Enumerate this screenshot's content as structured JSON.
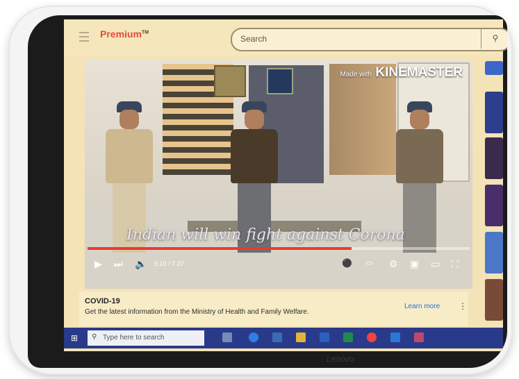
{
  "header": {
    "logo_text": "Premium",
    "logo_mark": "TM",
    "search_placeholder": "Search",
    "menu_icon": "hamburger-menu-icon",
    "search_icon": "search-icon"
  },
  "video": {
    "watermark_small": "Made with",
    "watermark": "KINEMASTER",
    "caption": "Indian will win fight against Corona",
    "time": "5:10 / 7:27",
    "progress": 0.69,
    "accent": "#e83b2e",
    "controls": [
      "play-icon",
      "next-icon",
      "volume-icon",
      "autoplay-toggle",
      "subtitles-icon",
      "settings-gear-icon",
      "miniplayer-icon",
      "theater-icon",
      "fullscreen-icon"
    ]
  },
  "info_banner": {
    "title": "COVID-19",
    "description": "Get the latest information from the Ministry of Health and Family Welfare.",
    "link": "Learn more"
  },
  "taskbar": {
    "search_placeholder": "Type here to search",
    "color": "#2a3a8a"
  },
  "monitor_brand": "Lenovo"
}
